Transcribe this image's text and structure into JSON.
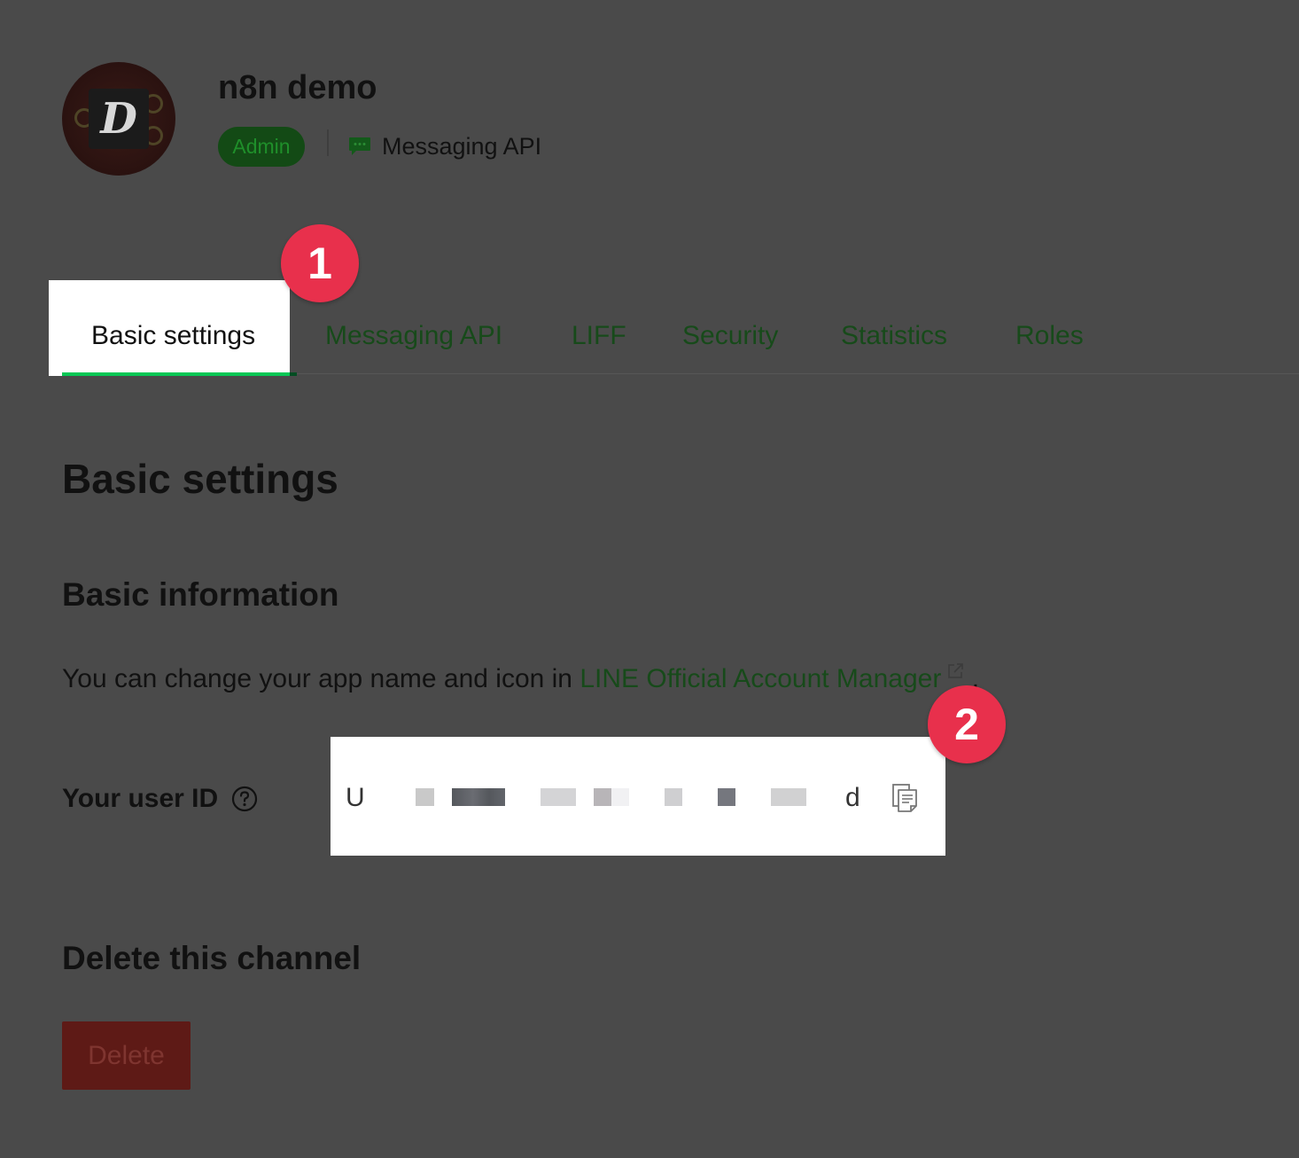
{
  "header": {
    "avatar_letter": "D",
    "app_name": "n8n demo",
    "role_badge": "Admin",
    "channel_type": "Messaging API",
    "channel_icon": "chat-bubble-icon"
  },
  "tabs": [
    {
      "label": "Basic settings",
      "active": true
    },
    {
      "label": "Messaging API",
      "active": false
    },
    {
      "label": "LIFF",
      "active": false
    },
    {
      "label": "Security",
      "active": false
    },
    {
      "label": "Statistics",
      "active": false
    },
    {
      "label": "Roles",
      "active": false
    }
  ],
  "markers": [
    "1",
    "2"
  ],
  "content": {
    "page_title": "Basic settings",
    "basic_info_title": "Basic information",
    "info_text": "You can change your app name and icon in",
    "info_link": "LINE Official Account Manager",
    "info_period": ".",
    "user_id_label": "Your user ID",
    "user_id_prefix": "U",
    "user_id_suffix": "d",
    "delete_section_title": "Delete this channel",
    "delete_button": "Delete"
  },
  "colors": {
    "overlay_background": "#4a4a4a",
    "accent_green": "#06c755",
    "marker_red": "#e8304c",
    "delete_button": "#5e1a16"
  }
}
